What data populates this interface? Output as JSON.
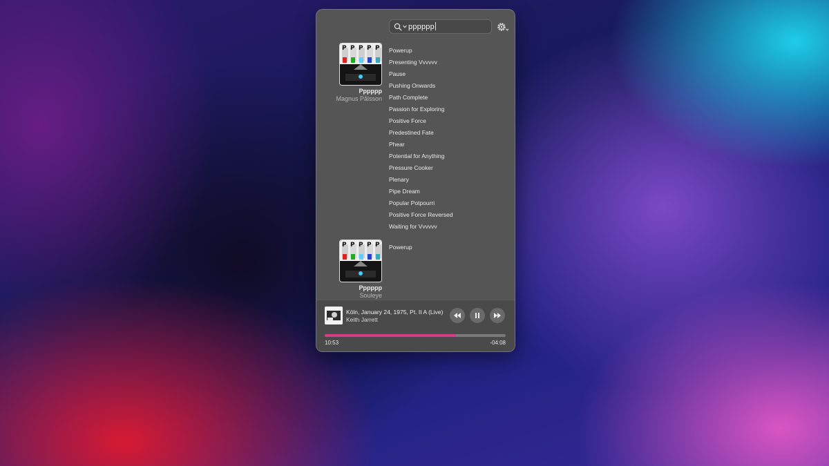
{
  "search": {
    "query": "pppppp"
  },
  "albums": [
    {
      "title": "Pppppp",
      "artist": "Magnus Pålsson",
      "tracks": [
        "Powerup",
        "Presenting Vvvvvv",
        "Pause",
        "Pushing Onwards",
        "Path Complete",
        "Passion for Exploring",
        "Positive Force",
        "Predestined Fate",
        "Phear",
        "Potential for Anything",
        "Pressure Cooker",
        "Plenary",
        "Pipe Dream",
        "Popular Potpourri",
        "Positive Force Reversed",
        "Waiting for Vvvvvv"
      ]
    },
    {
      "title": "Pppppp",
      "artist": "Souleye",
      "tracks": [
        "Powerup"
      ]
    }
  ],
  "now_playing": {
    "title": "Köln, January 24, 1975, Pt. II A (Live)",
    "artist": "Keith Jarrett",
    "elapsed": "10:53",
    "remaining": "-04:08",
    "progress": 0.727
  },
  "colors": {
    "accent": "#d93a86",
    "panel": "#555555"
  },
  "icons": {
    "search": "search-icon",
    "settings": "gear-icon",
    "prev": "rewind-icon",
    "pause": "pause-icon",
    "next": "fast-forward-icon"
  }
}
